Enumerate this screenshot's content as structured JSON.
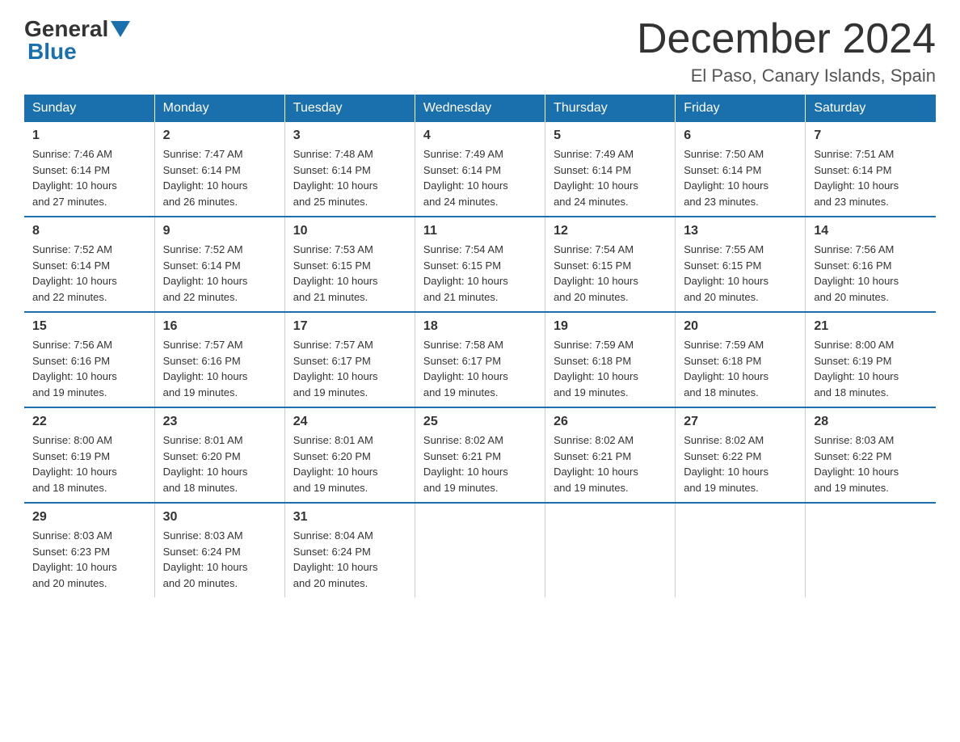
{
  "logo": {
    "general": "General",
    "blue": "Blue"
  },
  "title": "December 2024",
  "subtitle": "El Paso, Canary Islands, Spain",
  "days_of_week": [
    "Sunday",
    "Monday",
    "Tuesday",
    "Wednesday",
    "Thursday",
    "Friday",
    "Saturday"
  ],
  "weeks": [
    [
      {
        "day": "1",
        "sunrise": "7:46 AM",
        "sunset": "6:14 PM",
        "daylight": "10 hours and 27 minutes."
      },
      {
        "day": "2",
        "sunrise": "7:47 AM",
        "sunset": "6:14 PM",
        "daylight": "10 hours and 26 minutes."
      },
      {
        "day": "3",
        "sunrise": "7:48 AM",
        "sunset": "6:14 PM",
        "daylight": "10 hours and 25 minutes."
      },
      {
        "day": "4",
        "sunrise": "7:49 AM",
        "sunset": "6:14 PM",
        "daylight": "10 hours and 24 minutes."
      },
      {
        "day": "5",
        "sunrise": "7:49 AM",
        "sunset": "6:14 PM",
        "daylight": "10 hours and 24 minutes."
      },
      {
        "day": "6",
        "sunrise": "7:50 AM",
        "sunset": "6:14 PM",
        "daylight": "10 hours and 23 minutes."
      },
      {
        "day": "7",
        "sunrise": "7:51 AM",
        "sunset": "6:14 PM",
        "daylight": "10 hours and 23 minutes."
      }
    ],
    [
      {
        "day": "8",
        "sunrise": "7:52 AM",
        "sunset": "6:14 PM",
        "daylight": "10 hours and 22 minutes."
      },
      {
        "day": "9",
        "sunrise": "7:52 AM",
        "sunset": "6:14 PM",
        "daylight": "10 hours and 22 minutes."
      },
      {
        "day": "10",
        "sunrise": "7:53 AM",
        "sunset": "6:15 PM",
        "daylight": "10 hours and 21 minutes."
      },
      {
        "day": "11",
        "sunrise": "7:54 AM",
        "sunset": "6:15 PM",
        "daylight": "10 hours and 21 minutes."
      },
      {
        "day": "12",
        "sunrise": "7:54 AM",
        "sunset": "6:15 PM",
        "daylight": "10 hours and 20 minutes."
      },
      {
        "day": "13",
        "sunrise": "7:55 AM",
        "sunset": "6:15 PM",
        "daylight": "10 hours and 20 minutes."
      },
      {
        "day": "14",
        "sunrise": "7:56 AM",
        "sunset": "6:16 PM",
        "daylight": "10 hours and 20 minutes."
      }
    ],
    [
      {
        "day": "15",
        "sunrise": "7:56 AM",
        "sunset": "6:16 PM",
        "daylight": "10 hours and 19 minutes."
      },
      {
        "day": "16",
        "sunrise": "7:57 AM",
        "sunset": "6:16 PM",
        "daylight": "10 hours and 19 minutes."
      },
      {
        "day": "17",
        "sunrise": "7:57 AM",
        "sunset": "6:17 PM",
        "daylight": "10 hours and 19 minutes."
      },
      {
        "day": "18",
        "sunrise": "7:58 AM",
        "sunset": "6:17 PM",
        "daylight": "10 hours and 19 minutes."
      },
      {
        "day": "19",
        "sunrise": "7:59 AM",
        "sunset": "6:18 PM",
        "daylight": "10 hours and 19 minutes."
      },
      {
        "day": "20",
        "sunrise": "7:59 AM",
        "sunset": "6:18 PM",
        "daylight": "10 hours and 18 minutes."
      },
      {
        "day": "21",
        "sunrise": "8:00 AM",
        "sunset": "6:19 PM",
        "daylight": "10 hours and 18 minutes."
      }
    ],
    [
      {
        "day": "22",
        "sunrise": "8:00 AM",
        "sunset": "6:19 PM",
        "daylight": "10 hours and 18 minutes."
      },
      {
        "day": "23",
        "sunrise": "8:01 AM",
        "sunset": "6:20 PM",
        "daylight": "10 hours and 18 minutes."
      },
      {
        "day": "24",
        "sunrise": "8:01 AM",
        "sunset": "6:20 PM",
        "daylight": "10 hours and 19 minutes."
      },
      {
        "day": "25",
        "sunrise": "8:02 AM",
        "sunset": "6:21 PM",
        "daylight": "10 hours and 19 minutes."
      },
      {
        "day": "26",
        "sunrise": "8:02 AM",
        "sunset": "6:21 PM",
        "daylight": "10 hours and 19 minutes."
      },
      {
        "day": "27",
        "sunrise": "8:02 AM",
        "sunset": "6:22 PM",
        "daylight": "10 hours and 19 minutes."
      },
      {
        "day": "28",
        "sunrise": "8:03 AM",
        "sunset": "6:22 PM",
        "daylight": "10 hours and 19 minutes."
      }
    ],
    [
      {
        "day": "29",
        "sunrise": "8:03 AM",
        "sunset": "6:23 PM",
        "daylight": "10 hours and 20 minutes."
      },
      {
        "day": "30",
        "sunrise": "8:03 AM",
        "sunset": "6:24 PM",
        "daylight": "10 hours and 20 minutes."
      },
      {
        "day": "31",
        "sunrise": "8:04 AM",
        "sunset": "6:24 PM",
        "daylight": "10 hours and 20 minutes."
      },
      null,
      null,
      null,
      null
    ]
  ],
  "labels": {
    "sunrise": "Sunrise:",
    "sunset": "Sunset:",
    "daylight": "Daylight:"
  }
}
